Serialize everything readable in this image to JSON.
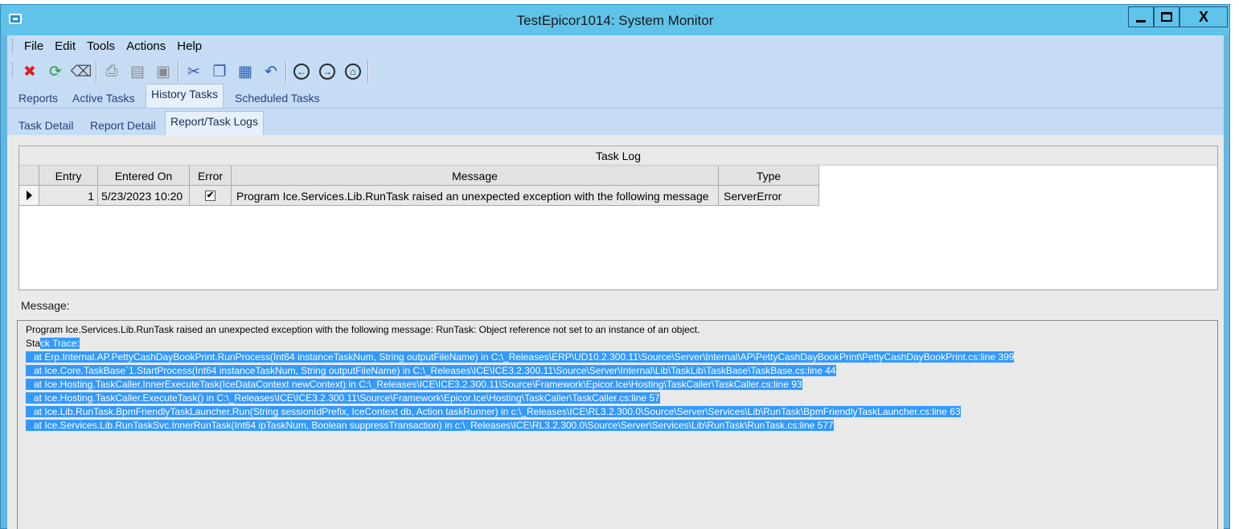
{
  "window": {
    "title": "TestEpicor1014: System Monitor",
    "close_glyph": "X"
  },
  "menu": [
    "File",
    "Edit",
    "Tools",
    "Actions",
    "Help"
  ],
  "toolbar": [
    {
      "name": "delete-icon",
      "glyph": "✖",
      "color": "#d92020"
    },
    {
      "name": "refresh-icon",
      "glyph": "⟳",
      "color": "#2a9a3a"
    },
    {
      "name": "clear-icon",
      "glyph": "⌫",
      "color": "#555555"
    },
    {
      "name": "print-icon",
      "glyph": "⎙",
      "color": "#8a8a8a"
    },
    {
      "name": "print-preview-icon",
      "glyph": "▤",
      "color": "#8a8a8a"
    },
    {
      "name": "save-icon",
      "glyph": "▣",
      "color": "#8a8a8a"
    },
    {
      "name": "cut-icon",
      "glyph": "✂",
      "color": "#2a5fb0"
    },
    {
      "name": "copy-icon",
      "glyph": "❐",
      "color": "#2a5fb0"
    },
    {
      "name": "paste-icon",
      "glyph": "▦",
      "color": "#2a5fb0"
    },
    {
      "name": "undo-icon",
      "glyph": "↶",
      "color": "#2a5fb0"
    },
    {
      "name": "back-icon",
      "glyph": "←",
      "color": "#2b2b2b"
    },
    {
      "name": "forward-icon",
      "glyph": "→",
      "color": "#2b2b2b"
    },
    {
      "name": "home-icon",
      "glyph": "⌂",
      "color": "#2b2b2b"
    }
  ],
  "tabs_main": [
    "Reports",
    "Active Tasks",
    "History Tasks",
    "Scheduled Tasks"
  ],
  "tabs_main_active": "History Tasks",
  "tabs_sub": [
    "Task Detail",
    "Report Detail",
    "Report/Task Logs"
  ],
  "tabs_sub_active": "Report/Task Logs",
  "grid": {
    "caption": "Task Log",
    "columns": [
      "Entry",
      "Entered On",
      "Error",
      "Message",
      "Type"
    ],
    "rows": [
      {
        "entry": "1",
        "entered_on": "5/23/2023 10:20",
        "error": true,
        "message": "Program Ice.Services.Lib.RunTask raised an unexpected exception with the following message",
        "type": "ServerError"
      }
    ]
  },
  "message_panel": {
    "label": "Message:",
    "line1": "Program Ice.Services.Lib.RunTask raised an unexpected exception with the following message: RunTask: Object reference not set to an instance of an object.",
    "trace_prefix": "Sta",
    "trace_heading": "ck Trace:",
    "trace_lines": [
      "   at Erp.Internal.AP.PettyCashDayBookPrint.RunProcess(Int64 instanceTaskNum, String outputFileName) in C:\\_Releases\\ERP\\UD10.2.300.11\\Source\\Server\\Internal\\AP\\PettyCashDayBookPrint\\PettyCashDayBookPrint.cs:line 399",
      "   at Ice.Core.TaskBase`1.StartProcess(Int64 instanceTaskNum, String outputFileName) in C:\\_Releases\\ICE\\ICE3.2.300.11\\Source\\Server\\Internal\\Lib\\TaskLib\\TaskBase\\TaskBase.cs:line 44",
      "   at Ice.Hosting.TaskCaller.InnerExecuteTask(IceDataContext newContext) in C:\\_Releases\\ICE\\ICE3.2.300.11\\Source\\Framework\\Epicor.Ice\\Hosting\\TaskCaller\\TaskCaller.cs:line 93",
      "   at Ice.Hosting.TaskCaller.ExecuteTask() in C:\\_Releases\\ICE\\ICE3.2.300.11\\Source\\Framework\\Epicor.Ice\\Hosting\\TaskCaller\\TaskCaller.cs:line 57",
      "   at Ice.Lib.RunTask.BpmFriendlyTaskLauncher.Run(String sessionIdPrefix, IceContext db, Action taskRunner) in c:\\_Releases\\ICE\\RL3.2.300.0\\Source\\Server\\Services\\Lib\\RunTask\\BpmFriendlyTaskLauncher.cs:line 63",
      "   at Ice.Services.Lib.RunTaskSvc.InnerRunTask(Int64 ipTaskNum, Boolean suppressTransaction) in c:\\_Releases\\ICE\\RL3.2.300.0\\Source\\Server\\Services\\Lib\\RunTask\\RunTask.cs:line 577"
    ]
  }
}
